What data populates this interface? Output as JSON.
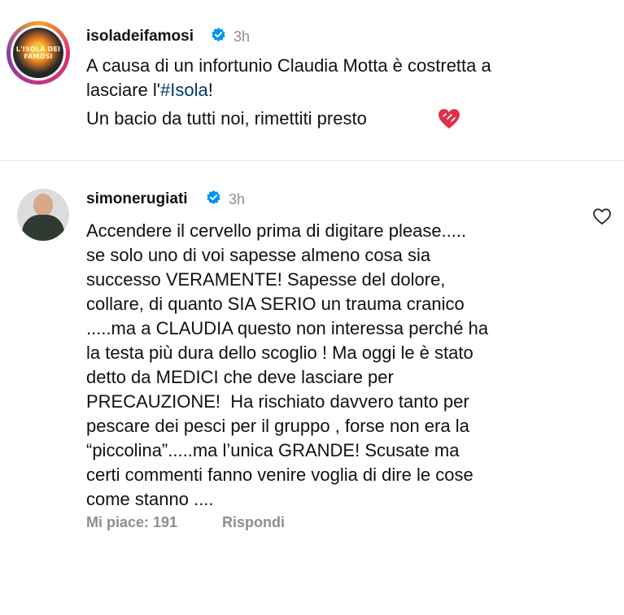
{
  "post": {
    "username": "isoladeifamosi",
    "time": "3h",
    "avatar_label": "L'ISOLA DEI FAMOSI",
    "line1": "A causa di un infortunio Claudia Motta è costretta a",
    "line2_prefix": "lasciare l'",
    "hashtag": "#Isola",
    "line2_suffix": "!",
    "line3": "Un bacio da tutti noi, rimettiti presto",
    "emoji": "heart-emoji"
  },
  "comment": {
    "username": "simonerugiati",
    "time": "3h",
    "text": "Accendere il cervello prima di digitare please.....\nse solo uno di voi sapesse almeno cosa sia\nsuccesso VERAMENTE! Sapesse del dolore,\ncollare, di quanto SIA SERIO un trauma cranico\n.....ma a CLAUDIA questo non interessa perché ha\nla testa più dura dello scoglio ! Ma oggi le è stato\ndetto da MEDICI che deve lasciare per\nPRECAUZIONE!  Ha rischiato davvero tanto per\npescare dei pesci per il gruppo , forse non era la\n“piccolina”.....ma l’unica GRANDE! Scusate ma\ncerti commenti fanno venire voglia di dire le cose\ncome stanno ....",
    "likes_label": "Mi piace: 191",
    "reply_label": "Rispondi",
    "like_icon": "heart-outline-icon"
  },
  "colors": {
    "verified": "#0095f6",
    "meta": "#8e8e8e",
    "hashtag": "#00376b"
  }
}
